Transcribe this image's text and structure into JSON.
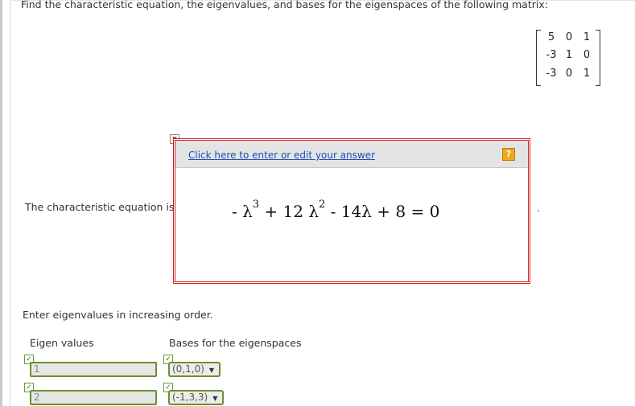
{
  "problem": {
    "text": "Find the characteristic equation, the eigenvalues, and bases for the eigenspaces of the following matrix:"
  },
  "matrix": {
    "rows": [
      [
        "5",
        "0",
        "1"
      ],
      [
        "-3",
        "1",
        "0"
      ],
      [
        "-3",
        "0",
        "1"
      ]
    ]
  },
  "answer_box": {
    "link_text": "Click here to enter or edit your answer",
    "help_icon": "?",
    "close_icon": "x",
    "equation": {
      "t1": "- λ",
      "e1": "3",
      "t2": " + 12 λ",
      "e2": "2",
      "t3": " - 14λ + 8 = 0"
    }
  },
  "characteristic_label": "The characteristic equation is",
  "trailing_period": ".",
  "eigen_prompt": "Enter eigenvalues in increasing order.",
  "columns": {
    "eigen_values": "Eigen values",
    "bases": "Bases for the eigenspaces"
  },
  "rows": [
    {
      "eigen_value": "1",
      "basis": "(0,1,0)"
    },
    {
      "eigen_value": "2",
      "basis": "(-1,3,3)"
    }
  ],
  "check_icon": "✓",
  "dropdown_arrow": "▼",
  "colors": {
    "answer_border": "#d21f1f",
    "link": "#1c4fb5",
    "correct_border": "#6b8f2e",
    "help": "#f0a81a"
  }
}
